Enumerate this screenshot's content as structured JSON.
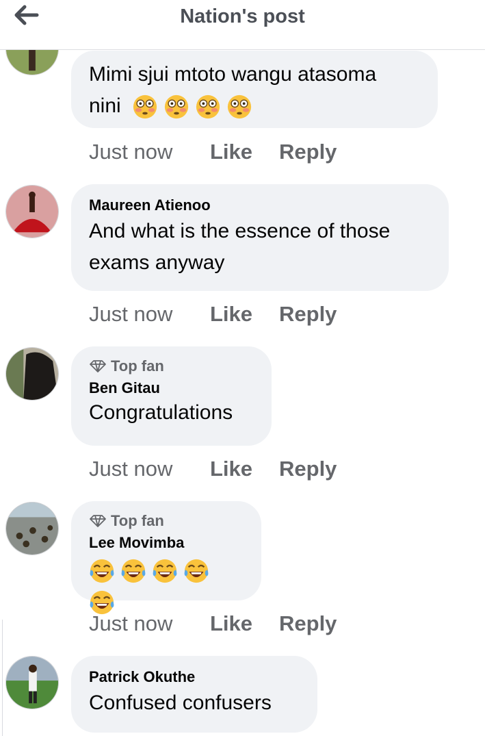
{
  "header": {
    "title": "Nation's post",
    "back_icon": "arrow-left-icon"
  },
  "colors": {
    "bubble": "#f0f2f5",
    "secondary_text": "#65676b",
    "header_text": "#4b4f56"
  },
  "comments": [
    {
      "author": "",
      "top_fan": false,
      "text_lines": [
        "Mimi sjui mtoto wangu atasoma",
        "nini"
      ],
      "emojis": [
        "flushed-face",
        "flushed-face",
        "flushed-face",
        "flushed-face"
      ],
      "time": "Just now",
      "like": "Like",
      "reply": "Reply"
    },
    {
      "author": "Maureen Atienoo",
      "top_fan": false,
      "text_lines": [
        "And what is the essence of those",
        "exams anyway"
      ],
      "time": "Just now",
      "like": "Like",
      "reply": "Reply"
    },
    {
      "author": "Ben Gitau",
      "top_fan": true,
      "top_fan_label": "Top fan",
      "text_lines": [
        "Congratulations"
      ],
      "time": "Just now",
      "like": "Like",
      "reply": "Reply"
    },
    {
      "author": "Lee Movimba",
      "top_fan": true,
      "top_fan_label": "Top fan",
      "emojis": [
        "tears-of-joy",
        "tears-of-joy",
        "tears-of-joy",
        "tears-of-joy",
        "tears-of-joy"
      ],
      "time": "Just now",
      "like": "Like",
      "reply": "Reply"
    },
    {
      "author": "Patrick Okuthe",
      "top_fan": false,
      "text_lines": [
        "Confused confusers"
      ]
    }
  ]
}
